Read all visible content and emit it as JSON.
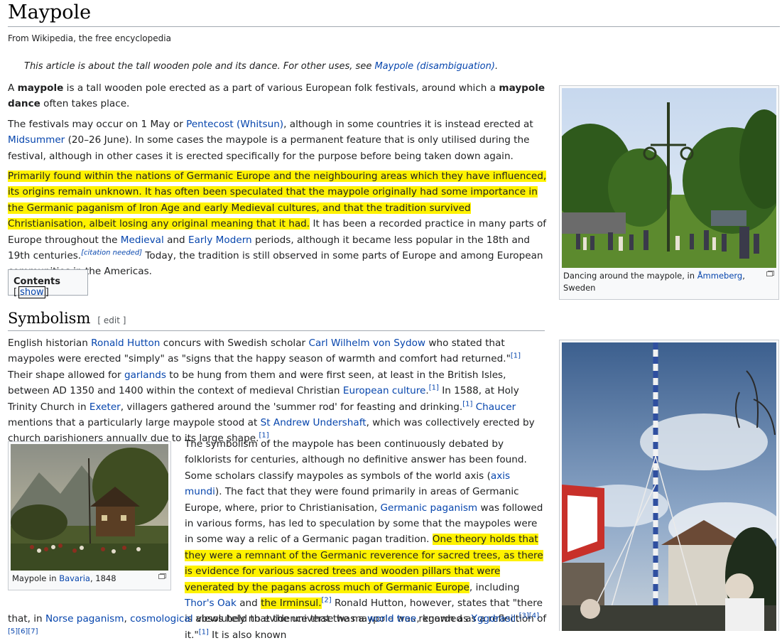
{
  "title": "Maypole",
  "tagline": "From Wikipedia, the free encyclopedia",
  "hatnote": {
    "text": "This article is about the tall wooden pole and its dance. For other uses, see ",
    "link": "Maypole (disambiguation)",
    "end": "."
  },
  "p1": {
    "t1": "A ",
    "b1": "maypole",
    "t2": " is a tall wooden pole erected as a part of various European folk festivals, around which a ",
    "b2": "maypole dance",
    "t3": " often takes place."
  },
  "p2": {
    "t1": "The festivals may occur on 1 May or ",
    "l1": "Pentecost",
    "t2": " ",
    "l2": "(Whitsun)",
    "t3": ", although in some countries it is instead erected at ",
    "l3": "Midsummer",
    "t4": " (20–26 June). In some cases the maypole is a permanent feature that is only utilised during the festival, although in other cases it is erected specifically for the purpose before being taken down again."
  },
  "p3": {
    "hl": "Primarily found within the nations of Germanic Europe and the neighbouring areas which they have influenced, its origins remain unknown. It has often been speculated that the maypole originally had some importance in the Germanic paganism of Iron Age and early Medieval cultures, and that the tradition survived Christianisation, albeit losing any original meaning that it had.",
    "t1": " It has been a recorded practice in many parts of Europe throughout the ",
    "l1": "Medieval",
    "t2": " and ",
    "l2": "Early Modern",
    "t3": " periods, although it became less popular in the 18th and 19th centuries.",
    "cite": "[citation needed]",
    "t4": " Today, the tradition is still observed in some parts of Europe and among European communities in the Americas."
  },
  "toc": {
    "label": "Contents",
    "open": " [",
    "toggle": "show",
    "close": "]"
  },
  "section": {
    "heading": "Symbolism",
    "edit": "[ edit ]"
  },
  "p4": {
    "t1": "English historian ",
    "l1": "Ronald Hutton",
    "t2": " concurs with Swedish scholar ",
    "l2": "Carl Wilhelm von Sydow",
    "t3": " who stated that maypoles were erected \"simply\" as \"signs that the happy season of warmth and comfort had returned.\"",
    "r1": "[1]",
    "t4": " Their shape allowed for ",
    "l3": "garlands",
    "t5": " to be hung from them and were first seen, at least in the British Isles, between AD 1350 and 1400 within the context of medieval Christian ",
    "l4": "European culture",
    "t6": ".",
    "r2": "[1]",
    "t7": " In 1588, at Holy Trinity Church in ",
    "l5": "Exeter",
    "t8": ", villagers gathered around the 'summer rod' for feasting and drinking.",
    "r3": "[1]",
    "t9": " ",
    "l6": "Chaucer",
    "t10": " mentions that a particularly large maypole stood at ",
    "l7": "St Andrew Undershaft",
    "t11": ", which was collectively erected by church parishioners annually due to its large shape.",
    "r4": "[1]"
  },
  "p5": {
    "t1": "The symbolism of the maypole has been continuously debated by folklorists for centuries, although no definitive answer has been found. Some scholars classify maypoles as symbols of the world axis (",
    "l1": "axis mundi",
    "t2": "). The fact that they were found primarily in areas of Germanic Europe, where, prior to Christianisation, ",
    "l2": "Germanic paganism",
    "t3": " was followed in various forms, has led to speculation by some that the maypoles were in some way a relic of a Germanic pagan tradition. ",
    "hl1": "One theory holds that they were a remnant of the Germanic reverence for sacred trees, as there is evidence for various sacred trees and wooden pillars that were venerated by the pagans across much of Germanic Europe",
    "t4": ", including ",
    "l3": "Thor's Oak",
    "t5": " and ",
    "hl2": "the Irminsul.",
    "r1": "[2]",
    "t6": " Ronald Hutton, however, states that \"there is absolutely no evidence that the maypole was regarded as a reflection of it.\"",
    "r2": "[1]",
    "t7": " It is also known"
  },
  "p5_tail": {
    "t1": "that, in ",
    "l1": "Norse paganism",
    "t2": ", ",
    "l2": "cosmological",
    "t3": " views held that the universe was a ",
    "l3": "world tree",
    "t4": ", known as ",
    "l4": "Yggdrasil",
    "t5": ".",
    "r1": "[3][4][5][6][7]"
  },
  "figures": {
    "fig1": {
      "caption_pre": "Dancing around the maypole, in ",
      "caption_link": "Åmmeberg",
      "caption_post": ", Sweden"
    },
    "fig2": {
      "caption_pre": "Maypole in ",
      "caption_link": "Bavaria",
      "caption_post": ", 1848"
    }
  }
}
